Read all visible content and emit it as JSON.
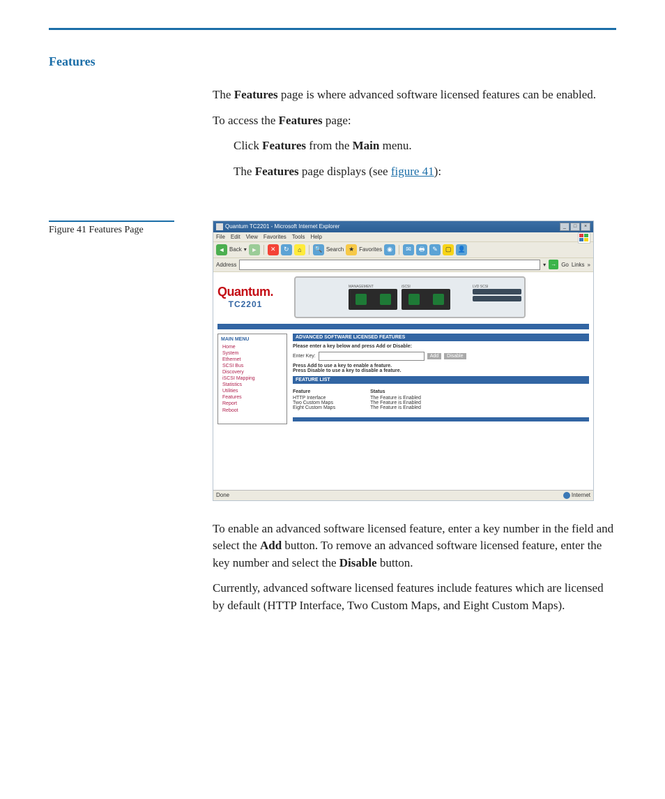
{
  "top_label": "Features",
  "intro": {
    "p1a": "The ",
    "p1b_bold": "Features",
    "p1c": " page is where advanced software licensed features can be enabled.",
    "p2a": "To access the ",
    "p2b_bold": "Features",
    "p2c": " page:",
    "step1a": "Click ",
    "step1b_bold": "Features",
    "step1c": " from the ",
    "step1d_bold": "Main",
    "step1e": " menu.",
    "step2a": "The ",
    "step2b_bold": "Features",
    "step2c": " page displays (see ",
    "step2d_link": "figure 41",
    "step2e": "):"
  },
  "figure_label": "Figure 41  Features Page",
  "screenshot": {
    "title": "Quantum TC2201 - Microsoft Internet Explorer",
    "menus": [
      "File",
      "Edit",
      "View",
      "Favorites",
      "Tools",
      "Help"
    ],
    "toolbar": {
      "back": "Back",
      "search": "Search",
      "favorites": "Favorites"
    },
    "address_label": "Address",
    "go": "Go",
    "links": "Links",
    "logo_main": "Quantum.",
    "logo_sub": "TC2201",
    "main_menu_title": "MAIN MENU",
    "menu_items": [
      "Home",
      "System",
      "Ethernet",
      "SCSI Bus",
      "Discovery",
      "iSCSI Mapping",
      "Statistics",
      "Utilities",
      "Features",
      "Report",
      "Reboot"
    ],
    "panel_title": "ADVANCED SOFTWARE LICENSED FEATURES",
    "panel_instr": "Please enter a key below and press Add or Disable:",
    "enter_key": "Enter Key:",
    "btn_add": "Add",
    "btn_disable": "Disable",
    "note1": "Press Add to use a key to enable a feature.",
    "note2": "Press Disable to use a key to disable a feature.",
    "feature_list_title": "FEATURE LIST",
    "col_feature": "Feature",
    "col_status": "Status",
    "features": [
      {
        "name": "HTTP Interface",
        "status": "The Feature is Enabled"
      },
      {
        "name": "Two Custom Maps",
        "status": "The Feature is Enabled"
      },
      {
        "name": "Eight Custom Maps",
        "status": "The Feature is Enabled"
      }
    ],
    "status_done": "Done",
    "status_zone": "Internet"
  },
  "after": {
    "p1a": "To enable an advanced software licensed feature, enter a key number in the field and select the ",
    "p1b_bold": "Add",
    "p1c": " button. To remove an advanced software licensed feature, enter the key number and select the ",
    "p1d_bold": "Disable",
    "p1e": " button.",
    "p2": "Currently, advanced software licensed features include features which are licensed by default (HTTP Interface, Two Custom Maps, and Eight Custom Maps)."
  }
}
